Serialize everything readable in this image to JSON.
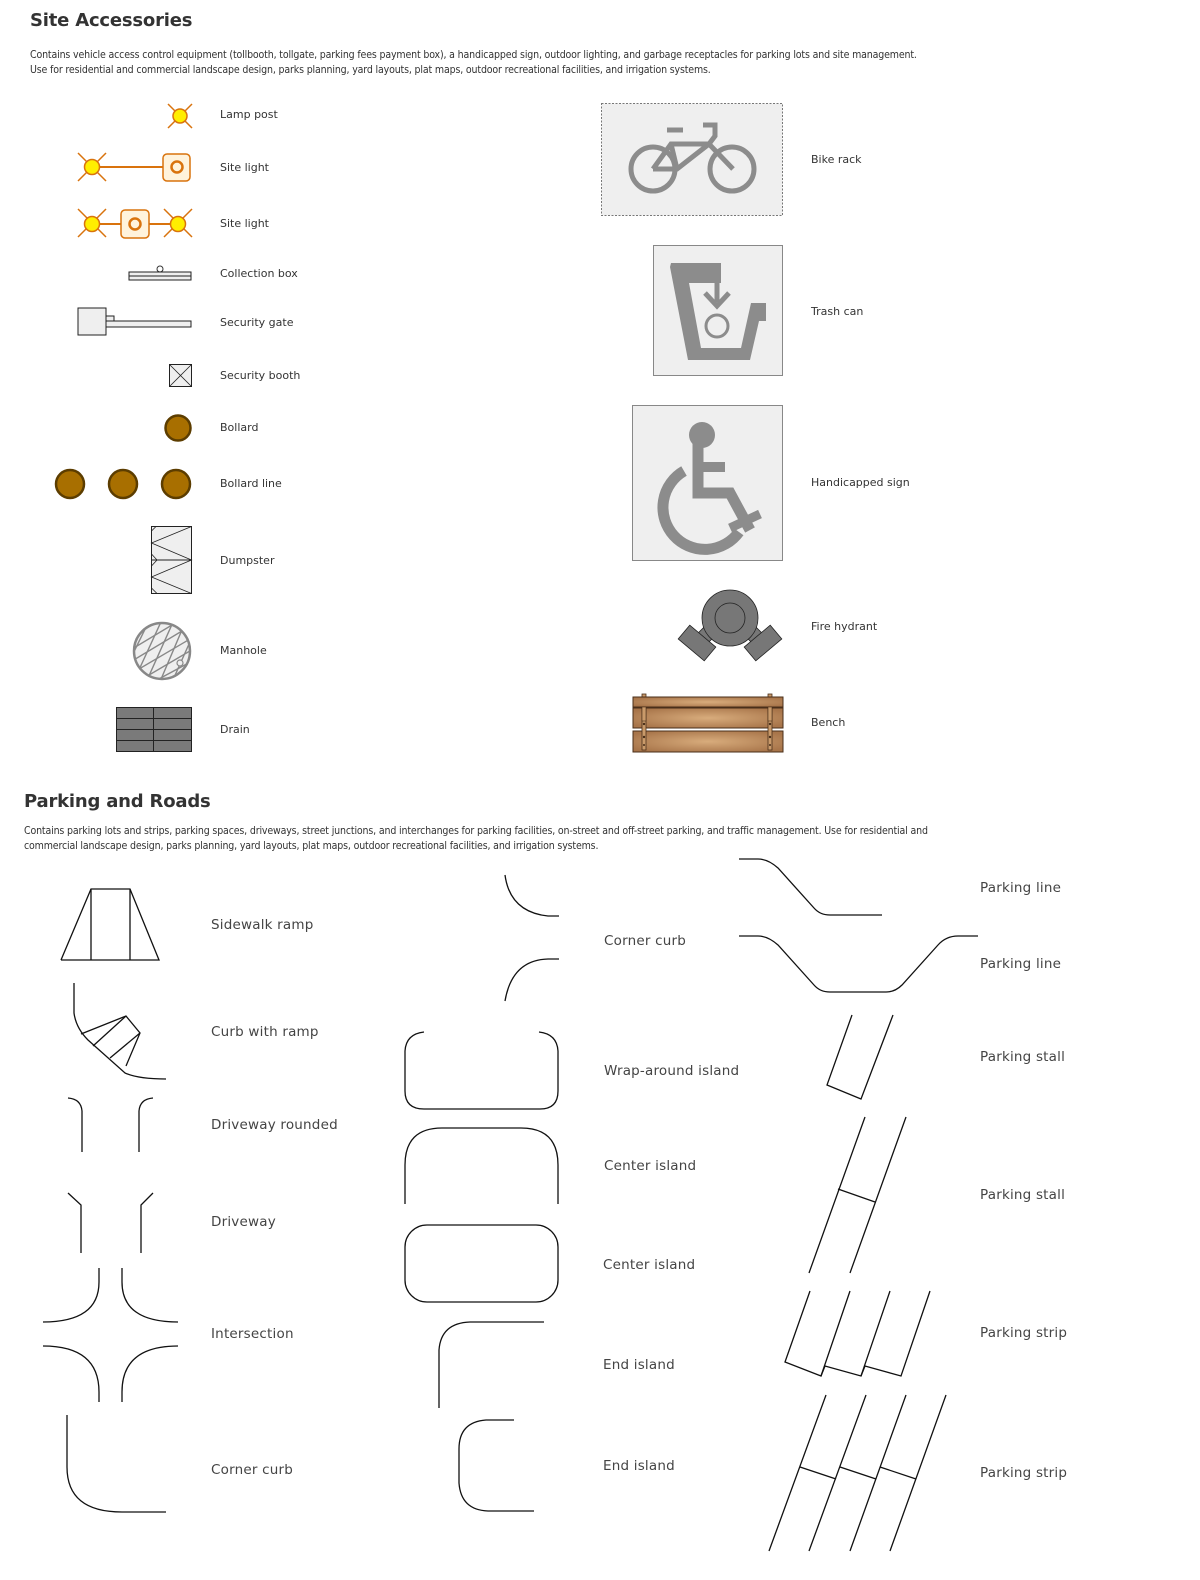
{
  "site_accessories": {
    "title": "Site Accessories",
    "description_line1": "Contains vehicle access control equipment (tollbooth, tollgate, parking fees payment box),  a handicapped sign, outdoor lighting, and garbage receptacles for parking lots and site management.",
    "description_line2": "Use for residential and commercial landscape design, parks planning, yard layouts, plat maps, outdoor recreational facilities, and irrigation systems.",
    "left_items": [
      {
        "label": "Lamp post",
        "icon": "lamp-post-icon"
      },
      {
        "label": "Site light",
        "icon": "site-light-icon"
      },
      {
        "label": "Site light",
        "icon": "site-light-double-icon"
      },
      {
        "label": "Collection box",
        "icon": "collection-box-icon"
      },
      {
        "label": "Security gate",
        "icon": "security-gate-icon"
      },
      {
        "label": "Security booth",
        "icon": "security-booth-icon"
      },
      {
        "label": "Bollard",
        "icon": "bollard-icon"
      },
      {
        "label": "Bollard line",
        "icon": "bollard-line-icon"
      },
      {
        "label": "Dumpster",
        "icon": "dumpster-icon"
      },
      {
        "label": "Manhole",
        "icon": "manhole-icon"
      },
      {
        "label": "Drain",
        "icon": "drain-icon"
      }
    ],
    "right_items": [
      {
        "label": "Bike rack",
        "icon": "bike-rack-icon"
      },
      {
        "label": "Trash can",
        "icon": "trash-can-icon"
      },
      {
        "label": "Handicapped sign",
        "icon": "wheelchair-icon"
      },
      {
        "label": "Fire hydrant",
        "icon": "fire-hydrant-icon"
      },
      {
        "label": "Bench",
        "icon": "bench-icon"
      }
    ],
    "colors": {
      "light_orange": "#D9730D",
      "light_yellow": "#FFEE00",
      "light_box_fill": "#FFF3DC",
      "bollard_fill": "#A86F00",
      "bollard_stroke": "#5C3D00",
      "sign_gray": "#8C8C8C",
      "sign_bg": "#EFEFEF",
      "hydrant_fill": "#777777",
      "bench_wood": "#C89A6A",
      "bench_stroke": "#4A2F1A"
    }
  },
  "parking_and_roads": {
    "title": "Parking and Roads",
    "description_line1": "Contains parking lots and strips, parking spaces, driveways, street junctions, and interchanges for parking facilities, on-street and off-street parking, and traffic management. Use for residential and",
    "description_line2": "commercial landscape design, parks planning, yard layouts, plat maps, outdoor recreational facilities, and irrigation systems.",
    "col1": [
      {
        "label": "Sidewalk ramp",
        "icon": "sidewalk-ramp-icon"
      },
      {
        "label": "Curb with ramp",
        "icon": "curb-with-ramp-icon"
      },
      {
        "label": "Driveway rounded",
        "icon": "driveway-rounded-icon"
      },
      {
        "label": "Driveway",
        "icon": "driveway-icon"
      },
      {
        "label": "Intersection",
        "icon": "intersection-icon"
      },
      {
        "label": "Corner curb",
        "icon": "corner-curb-icon"
      }
    ],
    "col2": [
      {
        "label": "Corner curb",
        "icon": "corner-curb-pair-icon"
      },
      {
        "label": "Wrap-around island",
        "icon": "wrap-around-island-icon"
      },
      {
        "label": "Center island",
        "icon": "center-island-open-icon"
      },
      {
        "label": "Center island",
        "icon": "center-island-closed-icon"
      },
      {
        "label": "End island",
        "icon": "end-island-long-icon"
      },
      {
        "label": "End island",
        "icon": "end-island-short-icon"
      }
    ],
    "col3": [
      {
        "label": "Parking line",
        "icon": "parking-line-single-icon"
      },
      {
        "label": "Parking line",
        "icon": "parking-line-double-icon"
      },
      {
        "label": "Parking stall",
        "icon": "parking-stall-short-icon"
      },
      {
        "label": "Parking stall",
        "icon": "parking-stall-long-icon"
      },
      {
        "label": "Parking strip",
        "icon": "parking-strip-short-icon"
      },
      {
        "label": "Parking strip",
        "icon": "parking-strip-long-icon"
      }
    ]
  }
}
